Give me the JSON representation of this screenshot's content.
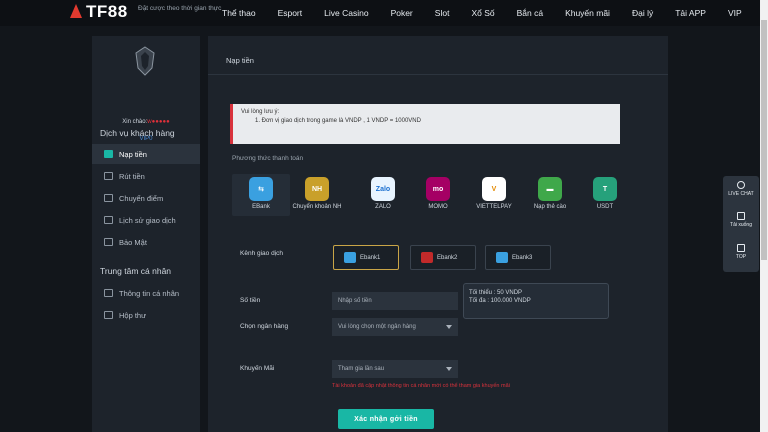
{
  "header": {
    "logo_text": "TF88",
    "tagline": "Đặt cược theo thời gian thực",
    "nav": [
      "Thể thao",
      "Esport",
      "Live Casino",
      "Poker",
      "Slot",
      "Xổ Số",
      "Bắn cá",
      "Khuyến mãi",
      "Đại lý",
      "Tải APP",
      "VIP"
    ]
  },
  "sidebar": {
    "greeting": "Xin chào:",
    "username": "w●●●●●",
    "vip": "VIP0",
    "section1": "Dịch vụ khách hàng",
    "items1": [
      "Nạp tiền",
      "Rút tiền",
      "Chuyển điểm",
      "Lịch sử giao dịch",
      "Bảo Mật"
    ],
    "section2": "Trung tâm cá nhân",
    "items2": [
      "Thông tin cá nhân",
      "Hộp thư"
    ]
  },
  "panel": {
    "title": "Nạp tiền",
    "notice_title": "Vui lòng lưu ý:",
    "notice_line": "1. Đơn vị giao dịch trong game là VNDP , 1 VNDP = 1000VND",
    "methods_label": "Phương thức thanh toán",
    "methods": [
      {
        "label": "EBank",
        "short": "⇆"
      },
      {
        "label": "Chuyển khoản NH",
        "short": "NH"
      },
      {
        "label": "ZALO",
        "short": "Zalo"
      },
      {
        "label": "MOMO",
        "short": "mo"
      },
      {
        "label": "VIETTELPAY",
        "short": "V"
      },
      {
        "label": "Nạp thẻ cào",
        "short": "▬"
      },
      {
        "label": "USDT",
        "short": "T"
      }
    ],
    "channel_label": "Kênh giao dịch",
    "channels": [
      "Ebank1",
      "Ebank2",
      "Ebank3"
    ],
    "amount_label": "Số tiền",
    "amount_placeholder": "Nhập số tiền",
    "limit_min": "Tối thiểu : 50 VNDP",
    "limit_max": "Tối đa : 100.000 VNDP",
    "bank_label": "Chọn ngân hàng",
    "bank_placeholder": "Vui lòng chọn một ngân hàng",
    "promo_label": "Khuyến Mãi",
    "promo_value": "Tham gia lần sau",
    "promo_note": "Tài khoản đã cập nhật thông tin cá nhân mới có thể tham gia khuyến mãi",
    "submit_label": "Xác nhận gởi tiền"
  },
  "float_menu": [
    "LIVE CHAT",
    "Tải xuống",
    "TOP"
  ],
  "colors": {
    "accent": "#19b7a5",
    "danger": "#d8323c",
    "brand": "#e23a2f"
  }
}
